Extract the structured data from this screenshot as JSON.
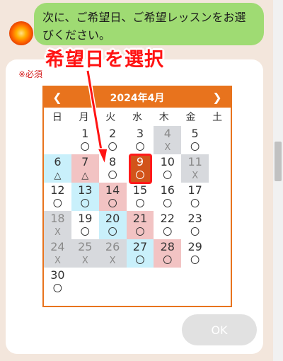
{
  "chat": {
    "message": "次に、ご希望日、ご希望レッスンをお選びください。"
  },
  "form": {
    "required_label": "※必須",
    "annotation_label": "希望日を選択",
    "ok_label": "OK"
  },
  "calendar": {
    "title": "2024年4月",
    "prev_icon": "chevron-left-icon",
    "next_icon": "chevron-right-icon",
    "weekdays": [
      "日",
      "月",
      "火",
      "水",
      "木",
      "金",
      "土"
    ],
    "selected_day": "9",
    "legend_marks": {
      "available": "〇",
      "few": "△",
      "full": "X"
    },
    "weeks": [
      [
        {
          "d": "",
          "m": ""
        },
        {
          "d": "1",
          "m": "〇"
        },
        {
          "d": "2",
          "m": "〇"
        },
        {
          "d": "3",
          "m": "〇"
        },
        {
          "d": "4",
          "m": "X"
        },
        {
          "d": "5",
          "m": "〇"
        },
        {
          "d": "6",
          "m": "△"
        }
      ],
      [
        {
          "d": "7",
          "m": "△"
        },
        {
          "d": "8",
          "m": "〇"
        },
        {
          "d": "9",
          "m": "〇"
        },
        {
          "d": "10",
          "m": "〇"
        },
        {
          "d": "11",
          "m": "X"
        },
        {
          "d": "12",
          "m": "〇"
        },
        {
          "d": "13",
          "m": "〇"
        }
      ],
      [
        {
          "d": "14",
          "m": "〇"
        },
        {
          "d": "15",
          "m": "〇"
        },
        {
          "d": "16",
          "m": "〇"
        },
        {
          "d": "17",
          "m": "〇"
        },
        {
          "d": "18",
          "m": "X"
        },
        {
          "d": "19",
          "m": "〇"
        },
        {
          "d": "20",
          "m": "〇"
        }
      ],
      [
        {
          "d": "21",
          "m": "〇"
        },
        {
          "d": "22",
          "m": "〇"
        },
        {
          "d": "23",
          "m": "〇"
        },
        {
          "d": "24",
          "m": "X"
        },
        {
          "d": "25",
          "m": "X"
        },
        {
          "d": "26",
          "m": "X"
        },
        {
          "d": "27",
          "m": "〇"
        }
      ],
      [
        {
          "d": "28",
          "m": "〇"
        },
        {
          "d": "29",
          "m": "〇"
        },
        {
          "d": "30",
          "m": "〇"
        },
        {
          "d": "",
          "m": ""
        },
        {
          "d": "",
          "m": ""
        },
        {
          "d": "",
          "m": ""
        },
        {
          "d": "",
          "m": ""
        }
      ]
    ]
  },
  "colors": {
    "accent": "#e8731d",
    "highlight": "#ff1a1a",
    "sunday_bg": "#f2c3c3",
    "saturday_bg": "#c9f0fb",
    "full_bg": "#d7d9dd",
    "bubble": "#9fdb73"
  }
}
